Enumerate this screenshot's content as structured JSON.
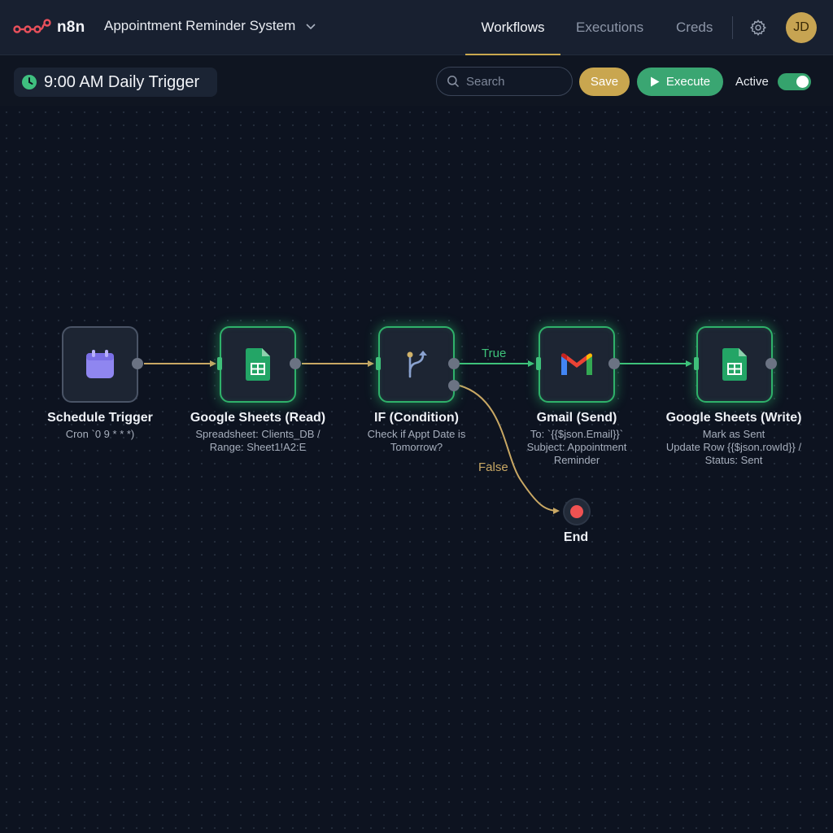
{
  "app": {
    "brand": "n8n",
    "workflow_title": "Appointment Reminder System"
  },
  "nav": {
    "workflows": "Workflows",
    "executions": "Executions",
    "creds": "Creds"
  },
  "user": {
    "initials": "JD"
  },
  "toolbar": {
    "trigger_label": "9:00 AM Daily Trigger",
    "search_placeholder": "Search",
    "save_label": "Save",
    "execute_label": "Execute",
    "active_label": "Active",
    "active": true
  },
  "nodes": [
    {
      "title": "Schedule Trigger",
      "sub": [
        "Cron `0 9 * * *)"
      ],
      "icon": "calendar-icon"
    },
    {
      "title": "Google Sheets (Read)",
      "sub": [
        "Spreadsheet: Clients_DB /",
        "Range: Sheet1!A2:E"
      ],
      "icon": "google-sheets-icon"
    },
    {
      "title": "IF (Condition)",
      "sub": [
        "Check if Appt Date is",
        "Tomorrow?"
      ],
      "icon": "branch-icon"
    },
    {
      "title": "Gmail (Send)",
      "sub": [
        "To: `{{$json.Email}}`",
        "Subject: Appointment",
        "Reminder"
      ],
      "icon": "gmail-icon"
    },
    {
      "title": "Google Sheets (Write)",
      "sub": [
        "Mark as Sent",
        "Update Row {{$json.rowId}} /",
        "Status: Sent"
      ],
      "icon": "google-sheets-icon"
    }
  ],
  "edges": {
    "true_label": "True",
    "false_label": "False"
  },
  "end_label": "End",
  "colors": {
    "accent_gold": "#c9a64f",
    "execute_green": "#3aa672",
    "node_glow": "#2fb16a",
    "end_red": "#f05252",
    "true_edge": "#3ec27a",
    "false_edge": "#c9a864"
  }
}
